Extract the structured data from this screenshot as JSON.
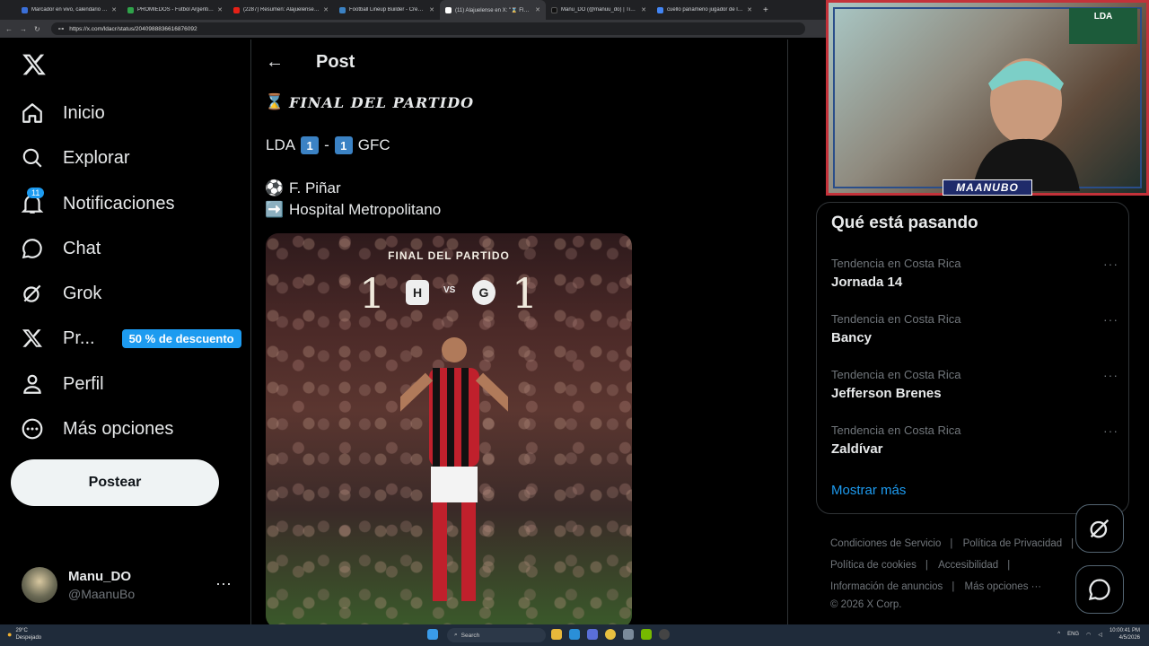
{
  "browser": {
    "tabs": [
      {
        "title": "Marcador en vivo, calendario y ...",
        "color": "#3a6fd8"
      },
      {
        "title": "PROMIEDOS - Futbol Argentino",
        "color": "#2fa34a"
      },
      {
        "title": "(2287) Resumen: Alajuelense 1...",
        "color": "#e62117"
      },
      {
        "title": "Football Lineup Builder - Creat...",
        "color": "#3b82c4"
      },
      {
        "title": "(11) Alajuelense en X: \"⌛ FIN...",
        "color": "#ffffff",
        "active": true
      },
      {
        "title": "Manu_DO (@manuu_do) | TikT...",
        "color": "#111111"
      },
      {
        "title": "cuello panameno jugador de la...",
        "color": "#4285f4"
      }
    ],
    "url": "https://x.com/ldacr/status/2040988836616876092"
  },
  "sidebar": {
    "items": [
      {
        "label": "Inicio",
        "icon": "home-icon"
      },
      {
        "label": "Explorar",
        "icon": "search-icon"
      },
      {
        "label": "Notificaciones",
        "icon": "bell-icon",
        "badge": "11"
      },
      {
        "label": "Chat",
        "icon": "chat-icon"
      },
      {
        "label": "Grok",
        "icon": "grok-icon"
      },
      {
        "label": "Pr...",
        "icon": "x-premium-icon",
        "promo": "50 % de descuento"
      },
      {
        "label": "Perfil",
        "icon": "user-icon"
      },
      {
        "label": "Más opciones",
        "icon": "more-circle-icon"
      }
    ],
    "post_button": "Postear",
    "profile": {
      "name": "Manu_DO",
      "handle": "@MaanuBo"
    }
  },
  "post": {
    "header": "Post",
    "line1_emoji": "⌛",
    "line1_text": "FINAL DEL PARTIDO",
    "score_home": "LDA",
    "score_home_goals": "1",
    "score_sep": "-",
    "score_away_goals": "1",
    "score_away": "GFC",
    "scorer_emoji": "⚽",
    "scorer": "F. Piñar",
    "venue_emoji": "➡️",
    "venue": "Hospital Metropolitano",
    "image": {
      "header": "FINAL DEL PARTIDO",
      "left_score": "1",
      "vs": "VS",
      "right_score": "1"
    }
  },
  "stream": {
    "overlay_name": "MAANUBO",
    "banner_text": "LDA"
  },
  "trends": {
    "title": "Qué está pasando",
    "items": [
      {
        "context": "Tendencia en Costa Rica",
        "name": "Jornada 14"
      },
      {
        "context": "Tendencia en Costa Rica",
        "name": "Bancy"
      },
      {
        "context": "Tendencia en Costa Rica",
        "name": "Jefferson Brenes"
      },
      {
        "context": "Tendencia en Costa Rica",
        "name": "Zaldívar"
      }
    ],
    "more": "Mostrar más"
  },
  "footer": {
    "links": [
      "Condiciones de Servicio",
      "Política de Privacidad",
      "Política de cookies",
      "Accesibilidad",
      "Información de anuncios",
      "Más opciones ···"
    ],
    "copyright": "© 2026 X Corp."
  },
  "taskbar": {
    "weather_temp": "29°C",
    "weather_text": "Despejado",
    "search": "Search",
    "lang": "ENG",
    "time": "10:00:41 PM",
    "date": "4/5/2026"
  }
}
